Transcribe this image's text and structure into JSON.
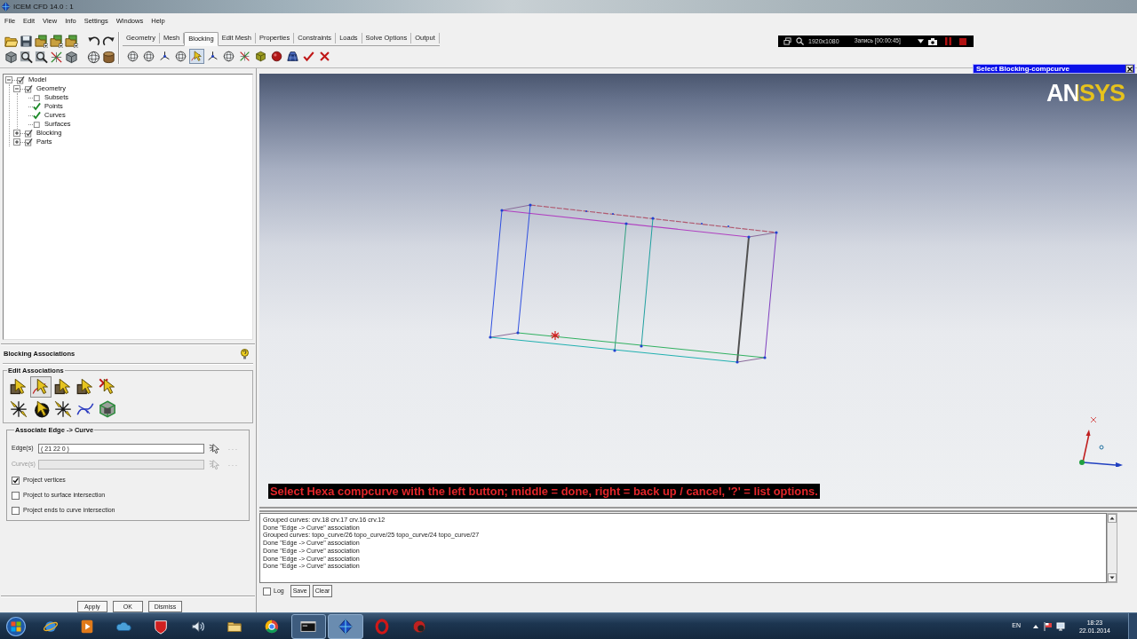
{
  "window": {
    "title": "ICEM CFD 14.0 : 1"
  },
  "menu": [
    "File",
    "Edit",
    "View",
    "Info",
    "Settings",
    "Windows",
    "Help"
  ],
  "tabs": [
    {
      "label": "Geometry",
      "selected": false
    },
    {
      "label": "Mesh",
      "selected": false
    },
    {
      "label": "Blocking",
      "selected": true
    },
    {
      "label": "Edit Mesh",
      "selected": false
    },
    {
      "label": "Properties",
      "selected": false
    },
    {
      "label": "Constraints",
      "selected": false
    },
    {
      "label": "Loads",
      "selected": false
    },
    {
      "label": "Solve Options",
      "selected": false
    },
    {
      "label": "Output",
      "selected": false
    }
  ],
  "blocking_tools": [
    {
      "selected": false
    },
    {
      "selected": false
    },
    {
      "selected": false
    },
    {
      "selected": false
    },
    {
      "selected": true
    },
    {
      "selected": false
    },
    {
      "selected": false
    },
    {
      "selected": false
    },
    {
      "selected": false
    },
    {
      "selected": false
    },
    {
      "selected": false
    },
    {
      "selected": false
    },
    {
      "selected": false
    }
  ],
  "recorder": {
    "resolution": "1920x1080",
    "status": "Запись [00:00:45]"
  },
  "select_window": {
    "title": "Select Blocking-compcurve"
  },
  "model_tree": [
    {
      "label": "Model",
      "checked": true,
      "expanded": true,
      "children": [
        {
          "label": "Geometry",
          "checked": true,
          "expanded": true,
          "children": [
            {
              "label": "Subsets",
              "checked": false
            },
            {
              "label": "Points",
              "checked": true
            },
            {
              "label": "Curves",
              "checked": true
            },
            {
              "label": "Surfaces",
              "checked": false
            }
          ]
        },
        {
          "label": "Blocking",
          "checked": true,
          "expanded": false
        },
        {
          "label": "Parts",
          "checked": true,
          "expanded": false
        }
      ]
    }
  ],
  "panel": {
    "title": "Blocking Associations",
    "edit_group": {
      "title": "Edit Associations",
      "tools": [
        {
          "selected": false
        },
        {
          "selected": true
        },
        {
          "selected": false
        },
        {
          "selected": false
        },
        {
          "selected": false
        },
        {
          "selected": false
        },
        {
          "selected": false
        },
        {
          "selected": false
        },
        {
          "selected": false
        },
        {
          "selected": false
        }
      ]
    },
    "assoc_group": {
      "title": "Associate Edge -> Curve",
      "fields": [
        {
          "label": "Edge(s)",
          "value": "( 21 22 0 )",
          "disabled": false,
          "more": "..."
        },
        {
          "label": "Curve(s)",
          "disabled": true,
          "more": "..."
        }
      ],
      "options": [
        {
          "label": "Project vertices",
          "checked": true
        },
        {
          "label": "Project to surface intersection",
          "checked": false
        },
        {
          "label": "Project ends to curve intersection",
          "checked": false
        }
      ]
    },
    "buttons": [
      "Apply",
      "OK",
      "Dismiss"
    ]
  },
  "viewport": {
    "logo": "ANSYS",
    "prompt": "Select Hexa compcurve with the left button; middle = done, right = back up / cancel, '?' = list options."
  },
  "log": {
    "lines": [
      "Grouped curves: crv.18 crv.17 crv.16 crv.12",
      "Done \"Edge -> Curve\" association",
      "Grouped curves: topo_curve/26 topo_curve/25 topo_curve/24 topo_curve/27",
      "Done \"Edge -> Curve\" association",
      "Done \"Edge -> Curve\" association",
      "Done \"Edge -> Curve\" association",
      "Done \"Edge -> Curve\" association"
    ],
    "log_option": {
      "label": "Log",
      "checked": false
    },
    "buttons": [
      "Save",
      "Clear"
    ]
  },
  "taskbar": {
    "apps": [
      {
        "running": false,
        "active": false
      },
      {
        "running": false,
        "active": false
      },
      {
        "running": false,
        "active": false
      },
      {
        "running": false,
        "active": false
      },
      {
        "running": false,
        "active": false
      },
      {
        "running": false,
        "active": false
      },
      {
        "running": false,
        "active": false
      },
      {
        "running": true,
        "active": false
      },
      {
        "running": true,
        "active": true
      },
      {
        "running": false,
        "active": false
      },
      {
        "running": false,
        "active": false
      }
    ],
    "language": "EN",
    "time": "18:23",
    "date": "22.01.2014"
  }
}
